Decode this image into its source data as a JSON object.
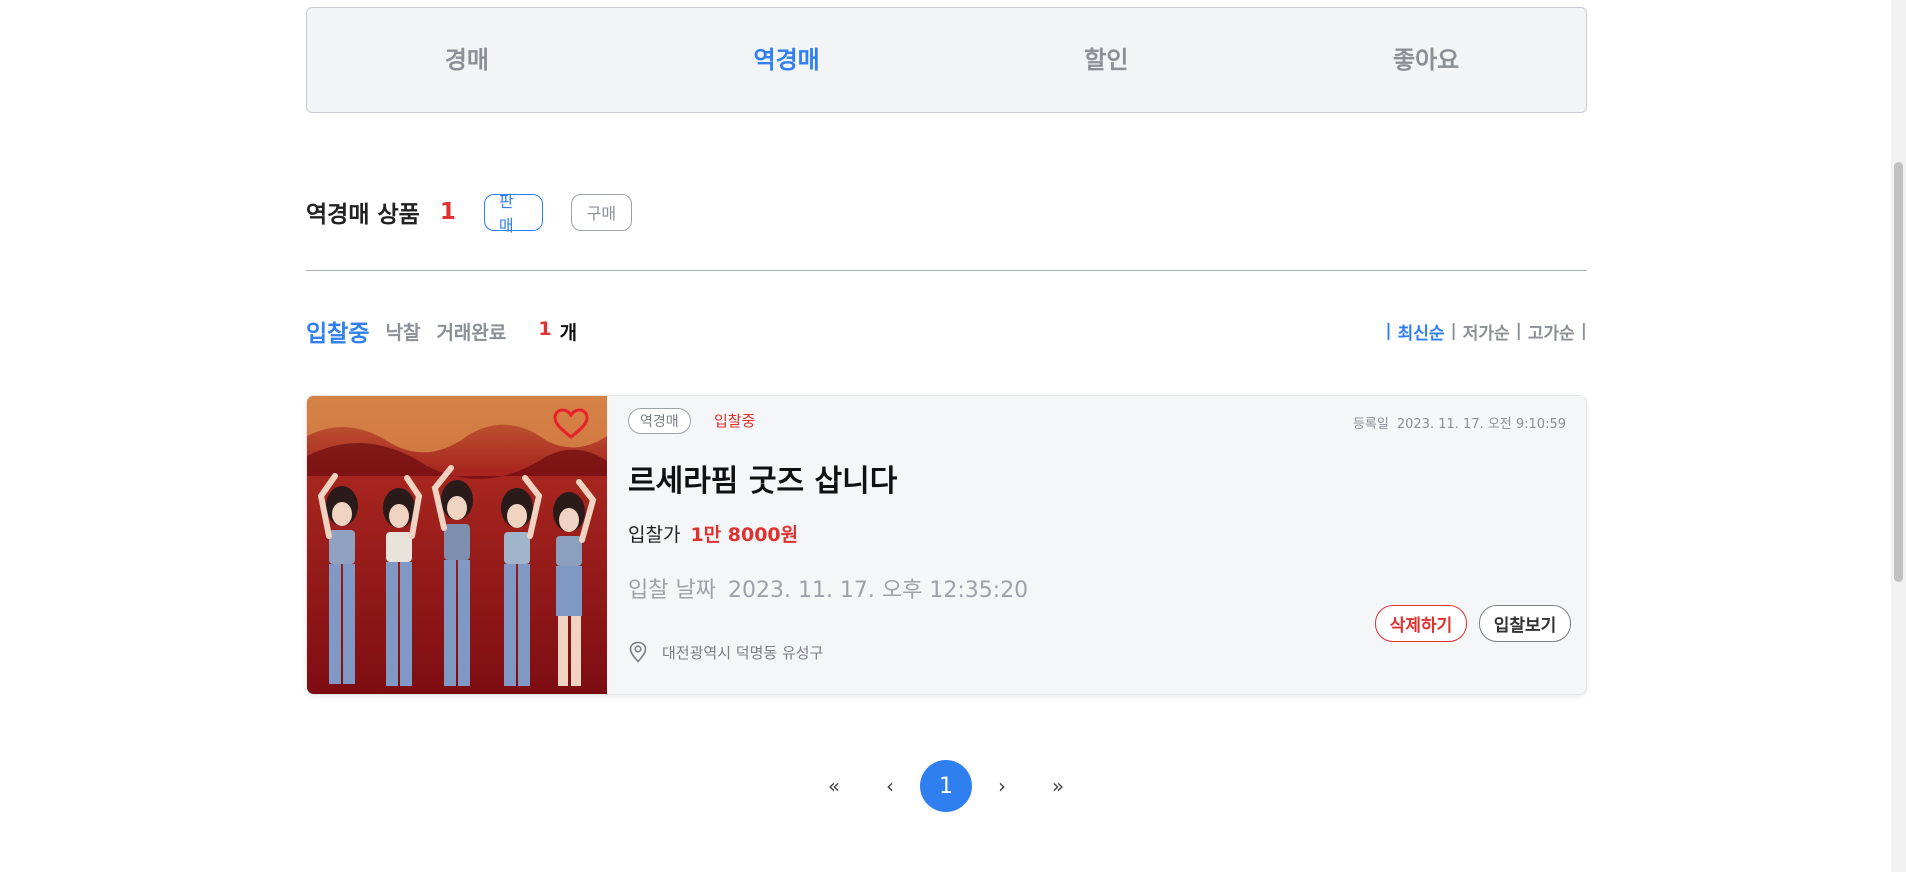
{
  "tabs": [
    {
      "label": "경매",
      "active": false
    },
    {
      "label": "역경매",
      "active": true
    },
    {
      "label": "할인",
      "active": false
    },
    {
      "label": "좋아요",
      "active": false
    }
  ],
  "section": {
    "title": "역경매 상품",
    "count": "1",
    "sell_label": "판매",
    "buy_label": "구매"
  },
  "filters": {
    "active": "입찰중",
    "items": [
      "낙찰",
      "거래완료"
    ],
    "count": "1",
    "count_unit": "개"
  },
  "sort": {
    "active": "최신순",
    "items": [
      "저가순",
      "고가순"
    ]
  },
  "card": {
    "badge": "역경매",
    "status": "입찰중",
    "reg_label": "등록일",
    "reg_date": "2023. 11. 17. 오전 9:10:59",
    "title": "르세라핌 굿즈 삽니다",
    "price_label": "입찰가",
    "price_value": "1만 8000원",
    "bid_date_label": "입찰 날짜",
    "bid_date_value": "2023. 11. 17. 오후 12:35:20",
    "location": "대전광역시 덕명동 유성구",
    "delete_label": "삭제하기",
    "view_label": "입찰보기",
    "thumbnail_icon": "product-photo",
    "favorite_icon": "heart-icon"
  },
  "pagination": {
    "first": "«",
    "prev": "‹",
    "current": "1",
    "next": "›",
    "last": "»"
  },
  "colors": {
    "accent": "#2f7ff0",
    "danger": "#e03131",
    "muted": "#8b8f96"
  }
}
